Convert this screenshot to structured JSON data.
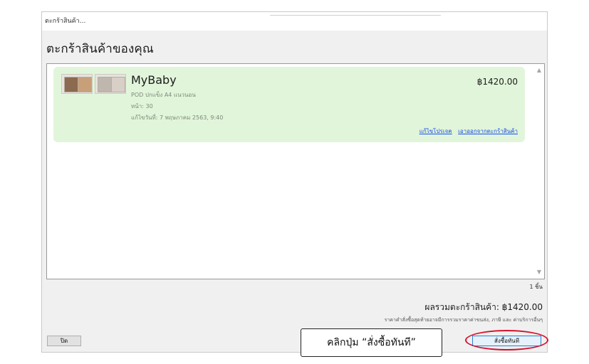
{
  "window": {
    "title": "ตะกร้าสินค้า..."
  },
  "heading": "ตะกร้าสินค้าของคุณ",
  "cart_item": {
    "name": "MyBaby",
    "product": "POD ปกแข็ง A4 แนวนอน",
    "pages": "หน้า: 30",
    "edited": "แก้ไขวันที่: 7 พฤษภาคม 2563, 9:40",
    "price": "฿1420.00",
    "edit_link": "แก้ไขโปรเจค",
    "remove_link": "เอาออกจากตะกร้าสินค้า"
  },
  "scrollbar": {
    "up_icon": "▲",
    "down_icon": "▼"
  },
  "summary": {
    "count": "1 ชิ้น",
    "total": "ผลรวมตะกร้าสินค้า: ฿1420.00",
    "disclaimer": "ราคาคำสั่งซื้อสุดท้ายอาจมีการรวมราคาค่าขนส่ง, ภาษี และ ค่าบริการอื่นๆ"
  },
  "buttons": {
    "close": "ปิด",
    "buy_now": "สั่งซื้อทันที"
  },
  "annotation": {
    "callout": "คลิกปุ่ม “สั่งซื้อทันที”",
    "highlight_color": "#d3132f"
  }
}
